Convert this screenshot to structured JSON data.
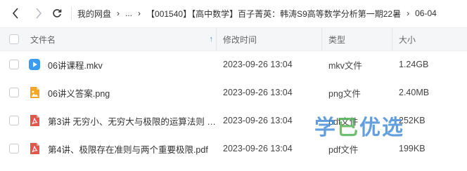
{
  "nav": {
    "breadcrumbs": [
      "我的网盘",
      "...",
      "【001540】【高中数学】百子菁英：韩涛S9高等数学分析第一期22暑",
      "06-04"
    ],
    "separator": "›"
  },
  "header": {
    "name": "文件名",
    "date": "修改时间",
    "type": "类型",
    "size": "大小",
    "sort_icon": "sort-ascending-icon"
  },
  "files": [
    {
      "name": "06讲课程.mkv",
      "date": "2023-09-26 13:04",
      "type": "mkv文件",
      "size": "1.24GB",
      "icon": "video-file-icon",
      "color": "#3a9bf0"
    },
    {
      "name": "06讲义答案.png",
      "date": "2023-09-26 13:04",
      "type": "png文件",
      "size": "2.40MB",
      "icon": "image-file-icon",
      "color": "#f5a623"
    },
    {
      "name": "第3讲 无穷小、无穷大与极限的运算法则 (...",
      "date": "2023-09-26 13:04",
      "type": "pdf文件",
      "size": "252KB",
      "icon": "pdf-file-icon",
      "color": "#e5534b"
    },
    {
      "name": "第4讲、极限存在准则与两个重要极限.pdf",
      "date": "2023-09-26 13:04",
      "type": "pdf文件",
      "size": "199KB",
      "icon": "pdf-file-icon",
      "color": "#e5534b"
    }
  ],
  "watermark": {
    "chars": [
      "学",
      "已",
      "优",
      "选"
    ]
  }
}
